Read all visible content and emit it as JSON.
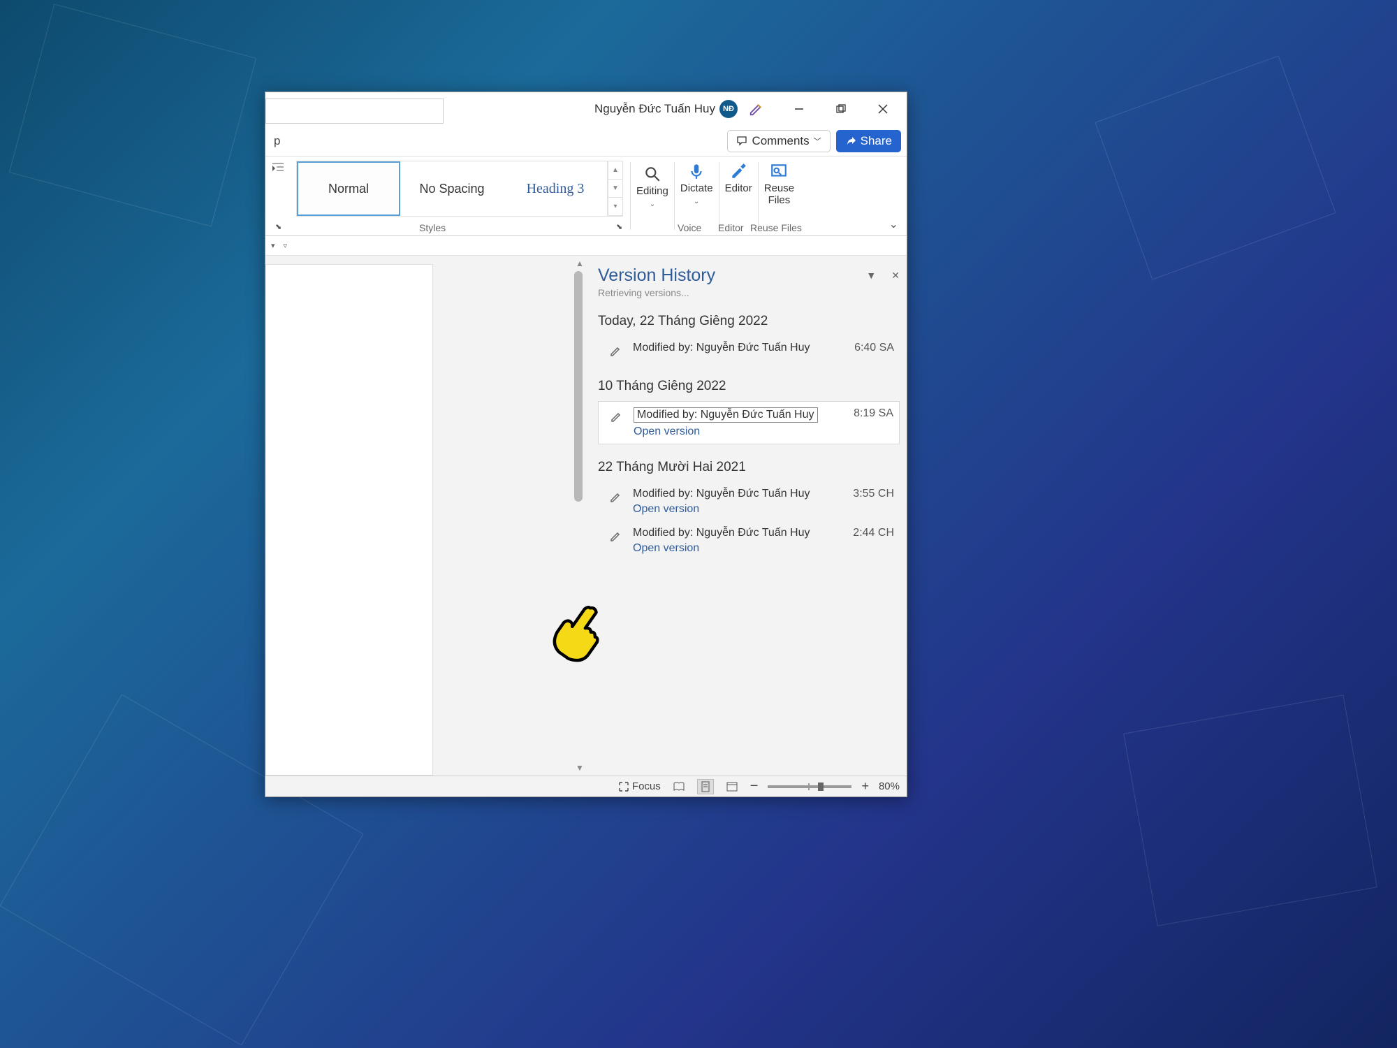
{
  "titlebar": {
    "user_name": "Nguyễn Đức Tuấn Huy",
    "avatar_initials": "NĐ"
  },
  "tabrow": {
    "tab_p": "p",
    "comments": "Comments",
    "share": "Share"
  },
  "ribbon": {
    "styles": {
      "normal": "Normal",
      "no_spacing": "No Spacing",
      "heading3": "Heading 3"
    },
    "editing": "Editing",
    "dictate": "Dictate",
    "editor": "Editor",
    "reuse": "Reuse\nFiles",
    "group_styles": "Styles",
    "group_voice": "Voice",
    "group_editor": "Editor",
    "group_reuse": "Reuse Files"
  },
  "version_panel": {
    "title": "Version History",
    "status": "Retrieving versions...",
    "groups": [
      {
        "date": "Today, 22 Tháng Giêng 2022",
        "items": [
          {
            "modified": "Modified by: Nguyễn Đức Tuấn Huy",
            "time": "6:40 SA",
            "open": "",
            "selected": false
          }
        ]
      },
      {
        "date": "10 Tháng Giêng 2022",
        "items": [
          {
            "modified": "Modified by: Nguyễn Đức Tuấn Huy",
            "time": "8:19 SA",
            "open": "Open version",
            "selected": true
          }
        ]
      },
      {
        "date": "22 Tháng Mười Hai 2021",
        "items": [
          {
            "modified": "Modified by: Nguyễn Đức Tuấn Huy",
            "time": "3:55 CH",
            "open": "Open version",
            "selected": false
          },
          {
            "modified": "Modified by: Nguyễn Đức Tuấn Huy",
            "time": "2:44 CH",
            "open": "Open version",
            "selected": false
          }
        ]
      }
    ]
  },
  "statusbar": {
    "focus": "Focus",
    "zoom": "80%"
  }
}
